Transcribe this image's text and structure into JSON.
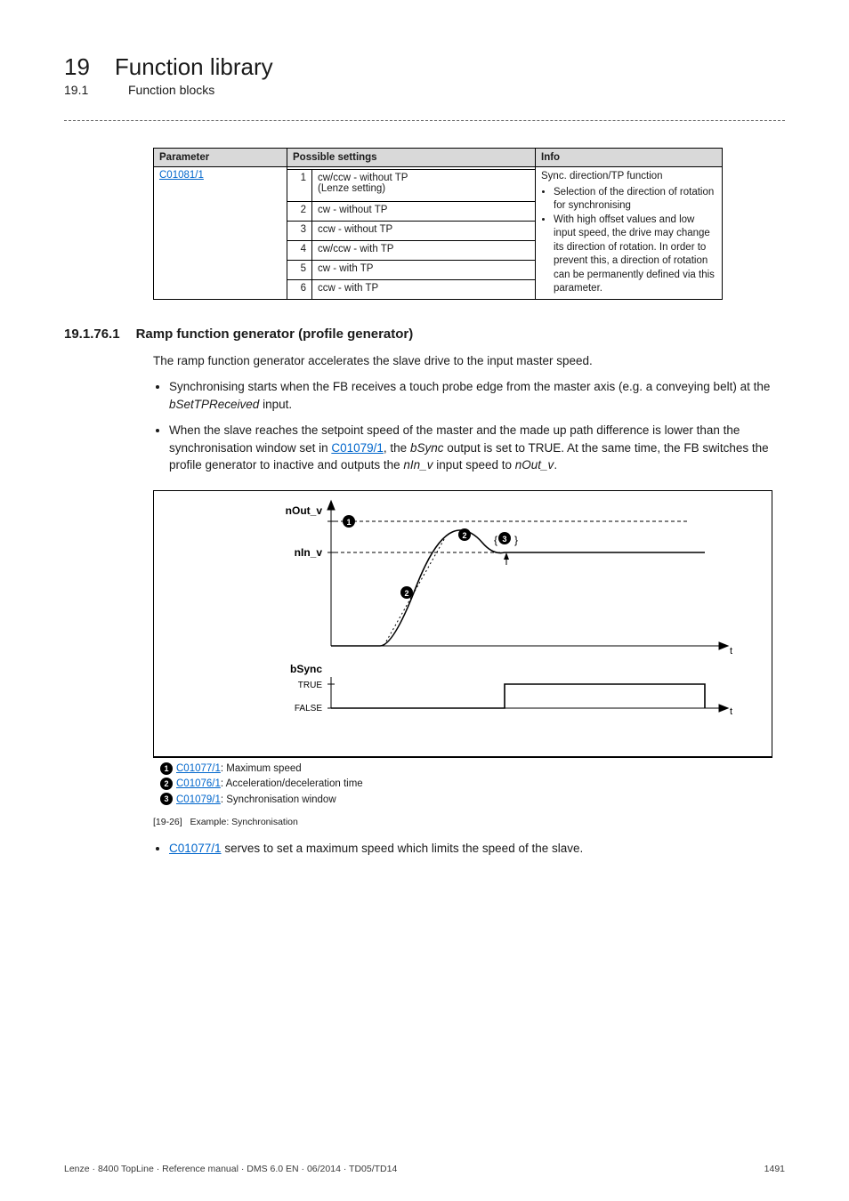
{
  "header": {
    "chapter_num": "19",
    "chapter_title": "Function library",
    "section_num": "19.1",
    "section_title": "Function blocks"
  },
  "table": {
    "headers": {
      "parameter": "Parameter",
      "settings": "Possible settings",
      "info": "Info"
    },
    "param_link": "C01081/1",
    "rows": [
      {
        "n": "1",
        "txt": "cw/ccw - without TP\n(Lenze setting)"
      },
      {
        "n": "2",
        "txt": "cw - without TP"
      },
      {
        "n": "3",
        "txt": "ccw - without TP"
      },
      {
        "n": "4",
        "txt": "cw/ccw - with TP"
      },
      {
        "n": "5",
        "txt": "cw - with TP"
      },
      {
        "n": "6",
        "txt": "ccw - with TP"
      }
    ],
    "info_title": "Sync. direction/TP function",
    "info_b1": "Selection of the direction of rotation for synchronising",
    "info_b2": "With high offset values and low input speed, the drive may change its direction of rotation. In order to prevent this, a direction of rotation can be permanently defined via this parameter."
  },
  "section": {
    "num": "19.1.76.1",
    "title": "Ramp function generator (profile generator)"
  },
  "body": {
    "intro": "The ramp function generator accelerates the slave drive to the input master speed.",
    "b1_pre": "Synchronising starts when the FB receives a touch probe edge from the master axis (e.g. a conveying belt) at the ",
    "b1_it": "bSetTPReceived",
    "b1_post": " input.",
    "b2_pre": "When the slave reaches the setpoint speed of the master and the made up path difference is lower than the synchronisation window set in ",
    "b2_link": "C01079/1",
    "b2_mid1": ", the ",
    "b2_it1": "bSync",
    "b2_mid2": " output is set to TRUE. At the same time, the FB switches the profile generator to inactive and outputs the ",
    "b2_it2": "nIn_v",
    "b2_mid3": " input speed to ",
    "b2_it3": "nOut_v",
    "b2_post": "."
  },
  "figure": {
    "y1": "nOut_v",
    "y2": "nIn_v",
    "sig": "bSync",
    "true": "TRUE",
    "false": "FALSE",
    "t": "t",
    "mark1": "1",
    "mark2": "2",
    "mark3": "3",
    "leg1_link": "C01077/1",
    "leg1_txt": ": Maximum speed",
    "leg2_link": "C01076/1",
    "leg2_txt": ": Acceleration/deceleration time",
    "leg3_link": "C01079/1",
    "leg3_txt": ": Synchronisation window",
    "caption_num": "[19-26]",
    "caption_txt": "Example: Synchronisation"
  },
  "bottom": {
    "link": "C01077/1",
    "txt": " serves to set a maximum speed which limits the speed of the slave."
  },
  "footer": {
    "left": "Lenze · 8400 TopLine · Reference manual · DMS 6.0 EN · 06/2014 · TD05/TD14",
    "right": "1491"
  }
}
